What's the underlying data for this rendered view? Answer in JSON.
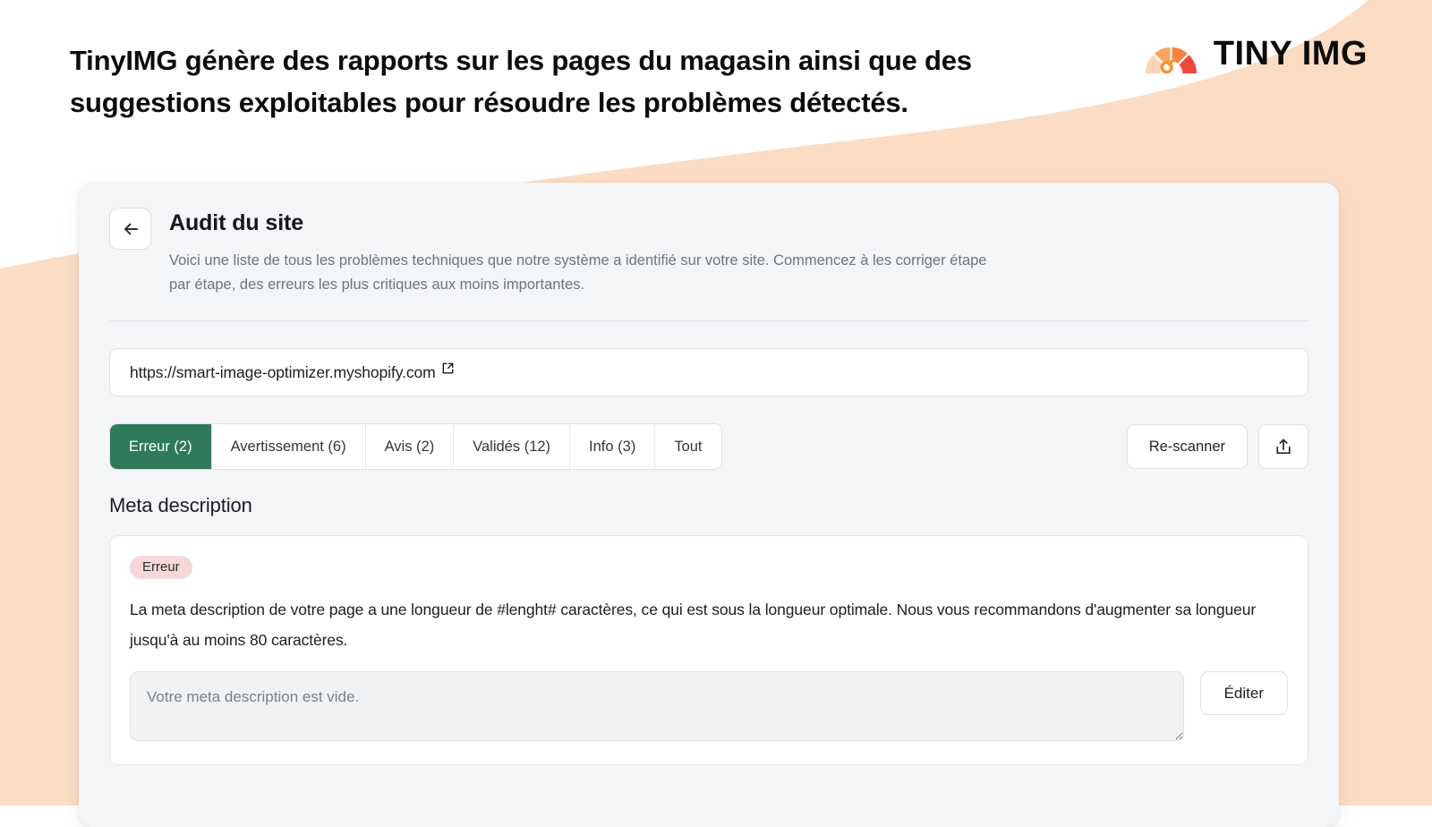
{
  "hero": {
    "headline": "TinyIMG génère des rapports sur les pages du magasin ainsi que des suggestions exploitables pour résoudre les problèmes détectés."
  },
  "brand": {
    "name": "TINY IMG",
    "mark_icon": "gauge-icon",
    "gauge_colors": [
      "#fcd3b6",
      "#fba45e",
      "#f9813f",
      "#f4483c"
    ],
    "needle_color": "#f8922f"
  },
  "theme": {
    "background": "#ffffff",
    "decoration": "#fcdcc3",
    "card_background": "#f4f5f7",
    "accent_green": "#2e7a5b",
    "badge_error_background": "#f6d8d8"
  },
  "card": {
    "back_icon": "arrow-left-icon",
    "title": "Audit du site",
    "subtitle": "Voici une liste de tous les problèmes techniques que notre système a identifié sur votre site. Commencez à les corriger étape par étape, des erreurs les plus critiques aux moins importantes."
  },
  "url_bar": {
    "value": "https://smart-image-optimizer.myshopify.com",
    "external_icon": "external-link-icon"
  },
  "tabs": [
    {
      "label": "Erreur (2)",
      "name": "tab-erreur",
      "active": true
    },
    {
      "label": "Avertissement (6)",
      "name": "tab-avertissement",
      "active": false
    },
    {
      "label": "Avis (2)",
      "name": "tab-avis",
      "active": false
    },
    {
      "label": "Validés (12)",
      "name": "tab-valides",
      "active": false
    },
    {
      "label": "Info (3)",
      "name": "tab-info",
      "active": false
    },
    {
      "label": "Tout",
      "name": "tab-tout",
      "active": false
    }
  ],
  "toolbar": {
    "rescan_label": "Re-scanner",
    "export_icon": "export-icon"
  },
  "issue_group": {
    "title": "Meta description",
    "severity_label": "Erreur",
    "description": "La meta description de votre page a une longueur de #lenght# caractères, ce qui est sous la longueur optimale. Nous vous recommandons d'augmenter sa longueur jusqu'à au moins 80 caractères.",
    "input_placeholder": "Votre meta description est vide.",
    "input_value": "",
    "edit_label": "Éditer"
  }
}
